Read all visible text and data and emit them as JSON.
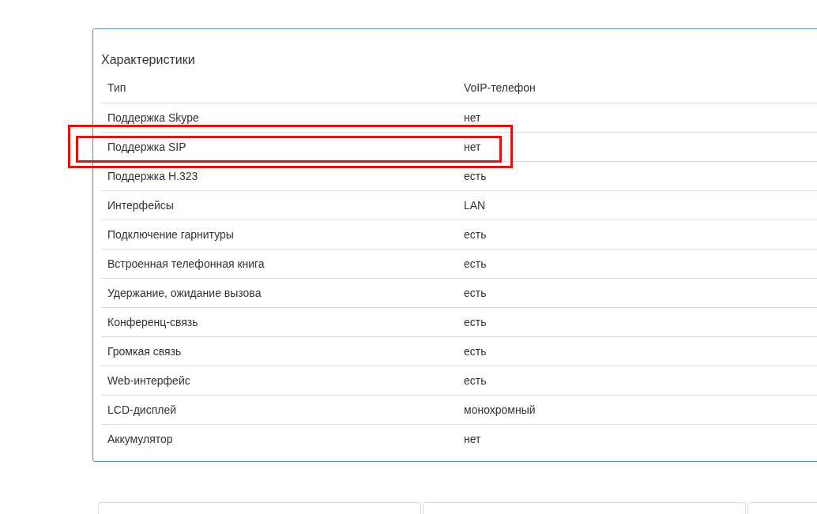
{
  "panel": {
    "title": "Характеристики",
    "rows": [
      {
        "label": "Тип",
        "value": "VoIP-телефон"
      },
      {
        "label": "Поддержка Skype",
        "value": "нет"
      },
      {
        "label": "Поддержка SIP",
        "value": "нет"
      },
      {
        "label": "Поддержка H.323",
        "value": "есть"
      },
      {
        "label": "Интерфейсы",
        "value": "LAN"
      },
      {
        "label": "Подключение гарнитуры",
        "value": "есть"
      },
      {
        "label": "Встроенная телефонная книга",
        "value": "есть"
      },
      {
        "label": "Удержание, ожидание вызова",
        "value": "есть"
      },
      {
        "label": "Конференц-связь",
        "value": "есть"
      },
      {
        "label": "Громкая связь",
        "value": "есть"
      },
      {
        "label": "Web-интерфейс",
        "value": "есть"
      },
      {
        "label": "LCD-дисплей",
        "value": "монохромный"
      },
      {
        "label": "Аккумулятор",
        "value": "нет"
      }
    ]
  },
  "highlight_frames": {
    "outer": true,
    "inner": true
  },
  "cards": [
    {
      "kind": "card"
    },
    {
      "kind": "card"
    },
    {
      "kind": "card"
    }
  ]
}
